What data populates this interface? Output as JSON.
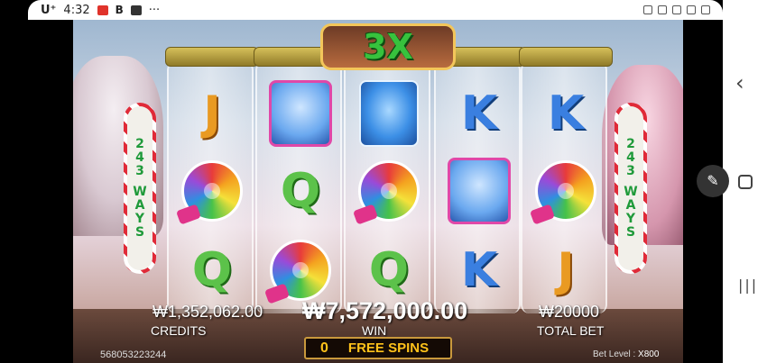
{
  "status_bar": {
    "carrier": "U⁺",
    "time": "4:32",
    "more": "···"
  },
  "game": {
    "multiplier": "3X",
    "ways_left": [
      "2",
      "4",
      "3",
      "W",
      "A",
      "Y",
      "S"
    ],
    "ways_right": [
      "2",
      "4",
      "3",
      "W",
      "A",
      "Y",
      "S"
    ],
    "reels": [
      [
        "J",
        "lollipop",
        "Q"
      ],
      [
        "gumball",
        "Q",
        "lollipop"
      ],
      [
        "gummy-bear",
        "lollipop",
        "Q"
      ],
      [
        "K",
        "gumball",
        "K"
      ],
      [
        "K",
        "lollipop",
        "J"
      ]
    ],
    "credits_value": "₩1,352,062.00",
    "credits_label": "CREDITS",
    "win_value": "₩7,572,000.00",
    "win_label": "WIN",
    "bet_value": "₩20000",
    "bet_label": "TOTAL BET",
    "free_spins_count": "0",
    "free_spins_label": "FREE SPINS",
    "game_id": "568053223244",
    "bet_level_label": "Bet Level :",
    "bet_level_value": "X800"
  },
  "colors": {
    "ways_text": "#1f9a3a",
    "free_spins_text": "#ffc21a",
    "multiplier_text": "#37c23d"
  }
}
